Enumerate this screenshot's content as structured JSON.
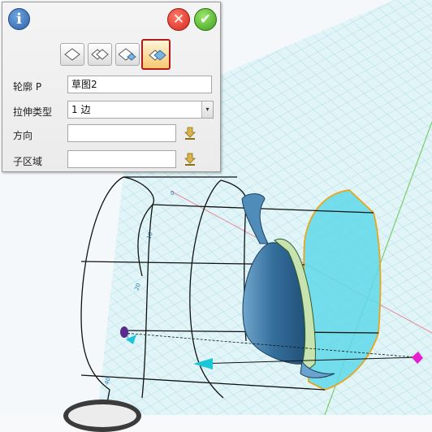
{
  "dialog": {
    "info_icon": "info-icon",
    "cancel_icon": "close-icon",
    "ok_icon": "checkmark-icon",
    "modes": [
      {
        "name": "extrude-mode-1",
        "selected": false
      },
      {
        "name": "extrude-mode-2",
        "selected": false
      },
      {
        "name": "extrude-mode-3",
        "selected": false
      },
      {
        "name": "extrude-mode-4",
        "selected": true
      }
    ],
    "fields": {
      "profile": {
        "label": "轮廓 P",
        "value": "草图2"
      },
      "extrude_type": {
        "label": "拉伸类型",
        "value": "1 边"
      },
      "direction": {
        "label": "方向",
        "value": ""
      },
      "sub_region": {
        "label": "子区域",
        "value": ""
      }
    }
  },
  "viewport": {
    "grid_labels": [
      "0",
      "10",
      "20",
      "30",
      "40"
    ],
    "colors": {
      "grid_fill": "#dff3f5",
      "grid_line": "#9fd6de",
      "face_highlight": "#5dd9ea",
      "highlight_edge": "#e8a61a",
      "body": "#3d7aa6",
      "handle": "#e61fcf",
      "arrow": "#19c7d8"
    }
  }
}
